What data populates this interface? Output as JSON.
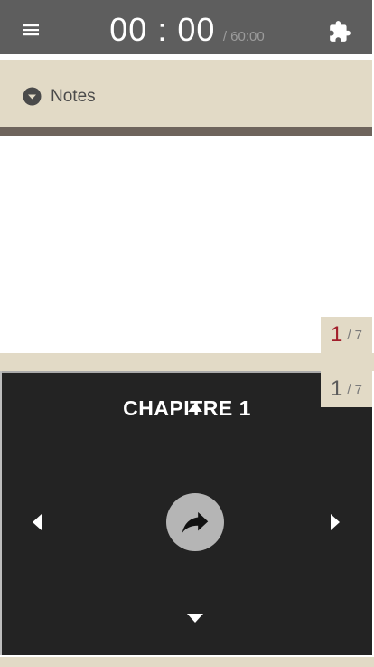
{
  "header": {
    "timer_elapsed": "00 : 00",
    "timer_total": "/ 60:00",
    "menu_icon": "hamburger-menu-icon",
    "puzzle_icon": "puzzle-piece-icon"
  },
  "notes": {
    "label": "Notes",
    "toggle_icon": "caret-down-circle-icon"
  },
  "pagination": [
    {
      "current": "1",
      "total": "/ 7"
    },
    {
      "current": "1",
      "total": "/ 7"
    }
  ],
  "chapter": {
    "title": "CHAPITRE 1"
  },
  "controls": {
    "share_icon": "share-forward-icon",
    "up_icon": "triangle-up-icon",
    "down_icon": "triangle-down-icon",
    "left_icon": "triangle-left-icon",
    "right_icon": "triangle-right-icon"
  },
  "colors": {
    "topbar": "#5e5e5e",
    "beige": "#e2dac6",
    "panel": "#232323",
    "accent_red": "#a21e2b"
  }
}
